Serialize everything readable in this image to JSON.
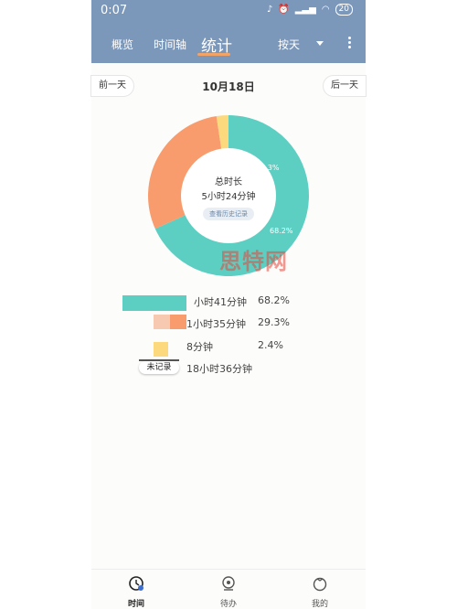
{
  "status_bar": {
    "time": "0:07",
    "battery": "20"
  },
  "nav": {
    "tabs": [
      "概览",
      "时间轴",
      "统计"
    ],
    "active_tab": "统计",
    "mode": "按天"
  },
  "date_bar": {
    "prev_label": "前一天",
    "date": "10月18日",
    "next_label": "后一天"
  },
  "center": {
    "title": "总时长",
    "value": "5小时24分钟",
    "history_button": "查看历史记录"
  },
  "colors": {
    "header": "#7b97ba",
    "teal": "#5ccfc2",
    "orange": "#f99c6d",
    "yellow": "#fdd97e",
    "accent": "#f4a366"
  },
  "chart_data": {
    "type": "pie",
    "donut": true,
    "slices": [
      {
        "label": "68.2%",
        "value": 68.2,
        "color": "#5ccfc2"
      },
      {
        "label": "29.3%",
        "value": 29.3,
        "color": "#f99c6d"
      },
      {
        "label": "",
        "value": 2.4,
        "color": "#fdd97e"
      }
    ]
  },
  "legend": [
    {
      "duration": "小时41分钟",
      "percent": "68.2%",
      "color": "#5ccfc2"
    },
    {
      "duration": "1小时35分钟",
      "percent": "29.3%",
      "color": "#f99c6d"
    },
    {
      "duration": "8分钟",
      "percent": "2.4%",
      "color": "#fdd97e"
    },
    {
      "no_record_label": "未记录",
      "duration": "18小时36分钟",
      "percent": ""
    }
  ],
  "watermark": "思特网",
  "bottom_nav": [
    {
      "label": "时间",
      "icon": "clock-icon"
    },
    {
      "label": "待办",
      "icon": "todo-icon"
    },
    {
      "label": "我的",
      "icon": "tomato-icon"
    }
  ]
}
